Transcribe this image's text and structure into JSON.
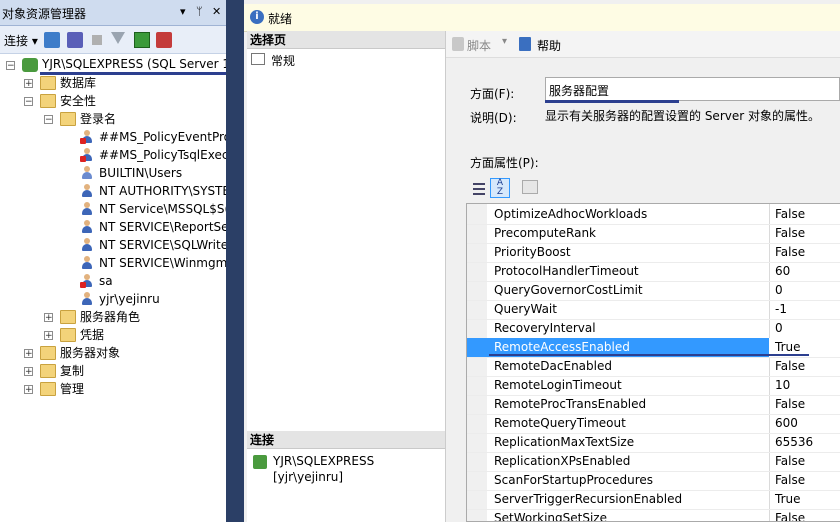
{
  "object_explorer": {
    "title": "对象资源管理器",
    "pin": "▼ ᛘ ✕",
    "connect": "连接 ▾",
    "server": "YJR\\SQLEXPRESS (SQL Server 1",
    "nodes": {
      "databases": "数据库",
      "security": "安全性",
      "logins": "登录名",
      "server_roles": "服务器角色",
      "credentials": "凭据",
      "server_objects": "服务器对象",
      "replication": "复制",
      "management": "管理"
    },
    "logins": [
      "##MS_PolicyEventPro",
      "##MS_PolicyTsqlExecu",
      "BUILTIN\\Users",
      "NT AUTHORITY\\SYSTE",
      "NT Service\\MSSQL$S(",
      "NT SERVICE\\ReportSe",
      "NT SERVICE\\SQLWrite",
      "NT SERVICE\\Winmgm",
      "sa",
      "yjr\\yejinru"
    ]
  },
  "dialog": {
    "status": "就绪",
    "select_page": "选择页",
    "general": "常规",
    "connection_header": "连接",
    "connection_server": "YJR\\SQLEXPRESS",
    "connection_user": "[yjr\\yejinru]",
    "script": "脚本",
    "help": "帮助",
    "facet_label": "方面(F):",
    "facet_value": "服务器配置",
    "description_label": "说明(D):",
    "description": "显示有关服务器的配置设置的 Server 对象的属性。",
    "facet_properties": "方面属性(P):"
  },
  "properties": [
    {
      "name": "OptimizeAdhocWorkloads",
      "value": "False"
    },
    {
      "name": "PrecomputeRank",
      "value": "False"
    },
    {
      "name": "PriorityBoost",
      "value": "False"
    },
    {
      "name": "ProtocolHandlerTimeout",
      "value": "60"
    },
    {
      "name": "QueryGovernorCostLimit",
      "value": "0"
    },
    {
      "name": "QueryWait",
      "value": "-1"
    },
    {
      "name": "RecoveryInterval",
      "value": "0"
    },
    {
      "name": "RemoteAccessEnabled",
      "value": "True"
    },
    {
      "name": "RemoteDacEnabled",
      "value": "False"
    },
    {
      "name": "RemoteLoginTimeout",
      "value": "10"
    },
    {
      "name": "RemoteProcTransEnabled",
      "value": "False"
    },
    {
      "name": "RemoteQueryTimeout",
      "value": "600"
    },
    {
      "name": "ReplicationMaxTextSize",
      "value": "65536"
    },
    {
      "name": "ReplicationXPsEnabled",
      "value": "False"
    },
    {
      "name": "ScanForStartupProcedures",
      "value": "False"
    },
    {
      "name": "ServerTriggerRecursionEnabled",
      "value": "True"
    },
    {
      "name": "SetWorkingSetSize",
      "value": "False"
    }
  ],
  "selected_property": "RemoteAccessEnabled",
  "colors": {
    "selection": "#3399ff",
    "underline": "#2c3f8f"
  }
}
